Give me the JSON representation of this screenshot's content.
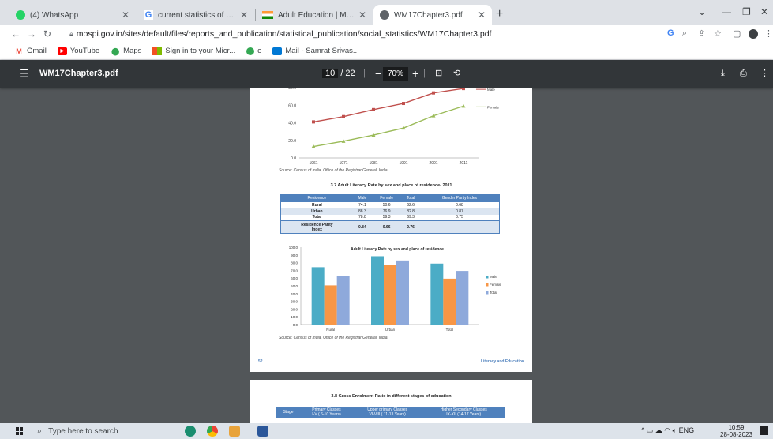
{
  "tabs": [
    {
      "title": "(4) WhatsApp",
      "icon": "whatsapp-icon"
    },
    {
      "title": "current statistics of adult educati",
      "icon": "google-icon"
    },
    {
      "title": "Adult Education | Ministry of Edu",
      "icon": "india-flag-icon"
    },
    {
      "title": "WM17Chapter3.pdf",
      "icon": "globe-icon",
      "active": true
    }
  ],
  "window_controls": {
    "minimize": "—",
    "restore": "❐",
    "close": "✕"
  },
  "toolbar": {
    "url": "mospi.gov.in/sites/default/files/reports_and_publication/statistical_publication/social_statistics/WM17Chapter3.pdf"
  },
  "bookmarks": [
    "Gmail",
    "YouTube",
    "Maps",
    "Sign in to your Micr...",
    "e",
    "Mail - Samrat Srivas..."
  ],
  "pdf": {
    "filename": "WM17Chapter3.pdf",
    "page_current": "10",
    "page_total": "/ 22",
    "zoom": "70%",
    "page_number": "52",
    "footer_title": "Literacy and Education"
  },
  "line_chart": {
    "y_ticks": [
      "80.0",
      "60.0",
      "40.0",
      "20.0",
      "0.0"
    ],
    "x_ticks": [
      "1961",
      "1971",
      "1981",
      "1991",
      "2001",
      "2011"
    ],
    "legend_male": "Male",
    "legend_female": "Female",
    "source": "Source: Census of India, Office of the Registrar General, India."
  },
  "table_title": "3.7  Adult Literacy Rate by sex and place of residence- 2011",
  "table": {
    "headers": [
      "Residence",
      "Male",
      "Female",
      "Total",
      "Gender Parity Index"
    ],
    "rows": [
      [
        "Rural",
        "74.1",
        "50.6",
        "62.6",
        "0.68"
      ],
      [
        "Urban",
        "88.3",
        "76.9",
        "82.8",
        "0.87"
      ],
      [
        "Total",
        "78.8",
        "59.3",
        "69.3",
        "0.75"
      ]
    ],
    "parity_label_1": "Residence Parity",
    "parity_label_2": "Index",
    "parity_values": [
      "0.84",
      "0.66",
      "0.76"
    ]
  },
  "chart_data": [
    {
      "type": "line",
      "x": [
        1961,
        1971,
        1981,
        1991,
        2001,
        2011
      ],
      "series": [
        {
          "name": "Male",
          "values": [
            41,
            47,
            55,
            62,
            74,
            79
          ],
          "color": "#c0504d"
        },
        {
          "name": "Female",
          "values": [
            13,
            19,
            26,
            34,
            48,
            59
          ],
          "color": "#9bbb59"
        }
      ],
      "ylim": [
        0,
        80
      ],
      "y_ticks": [
        0,
        20,
        40,
        60,
        80
      ],
      "legend": "right"
    },
    {
      "type": "bar",
      "title": "Adult Literacy Rate by sex and place of residence",
      "categories": [
        "Rural",
        "Urban",
        "Total"
      ],
      "series": [
        {
          "name": "Male",
          "values": [
            74.1,
            88.3,
            78.8
          ],
          "color": "#4bacc6"
        },
        {
          "name": "Female",
          "values": [
            50.6,
            76.9,
            59.3
          ],
          "color": "#f79646"
        },
        {
          "name": "Total",
          "values": [
            62.6,
            82.8,
            69.3
          ],
          "color": "#8ea9db"
        }
      ],
      "ylim": [
        0,
        100
      ],
      "y_ticks": [
        "100.0",
        "90.0",
        "80.0",
        "70.0",
        "60.0",
        "50.0",
        "40.0",
        "30.0",
        "20.0",
        "10.0",
        "0.0"
      ],
      "legend": "right",
      "source": "Source: Census of India, Office of the Registrar General, India."
    }
  ],
  "page2": {
    "title": "3.8  Gross Enrolment Ratio in different stages of education",
    "col1": "Stage",
    "col2a": "Primary Classes",
    "col2b": "I-V ( 6-10 Years)",
    "col3a": "Upper primary Classes",
    "col3b": "VI-VIII ( 11-13 Years)",
    "col4a": "Higher Secondary Classes",
    "col4b": "IX-XII (14-17 Years)"
  },
  "taskbar": {
    "search_placeholder": "Type here to search",
    "lang": "ENG",
    "time": "10:59",
    "date": "28-08-2023"
  }
}
